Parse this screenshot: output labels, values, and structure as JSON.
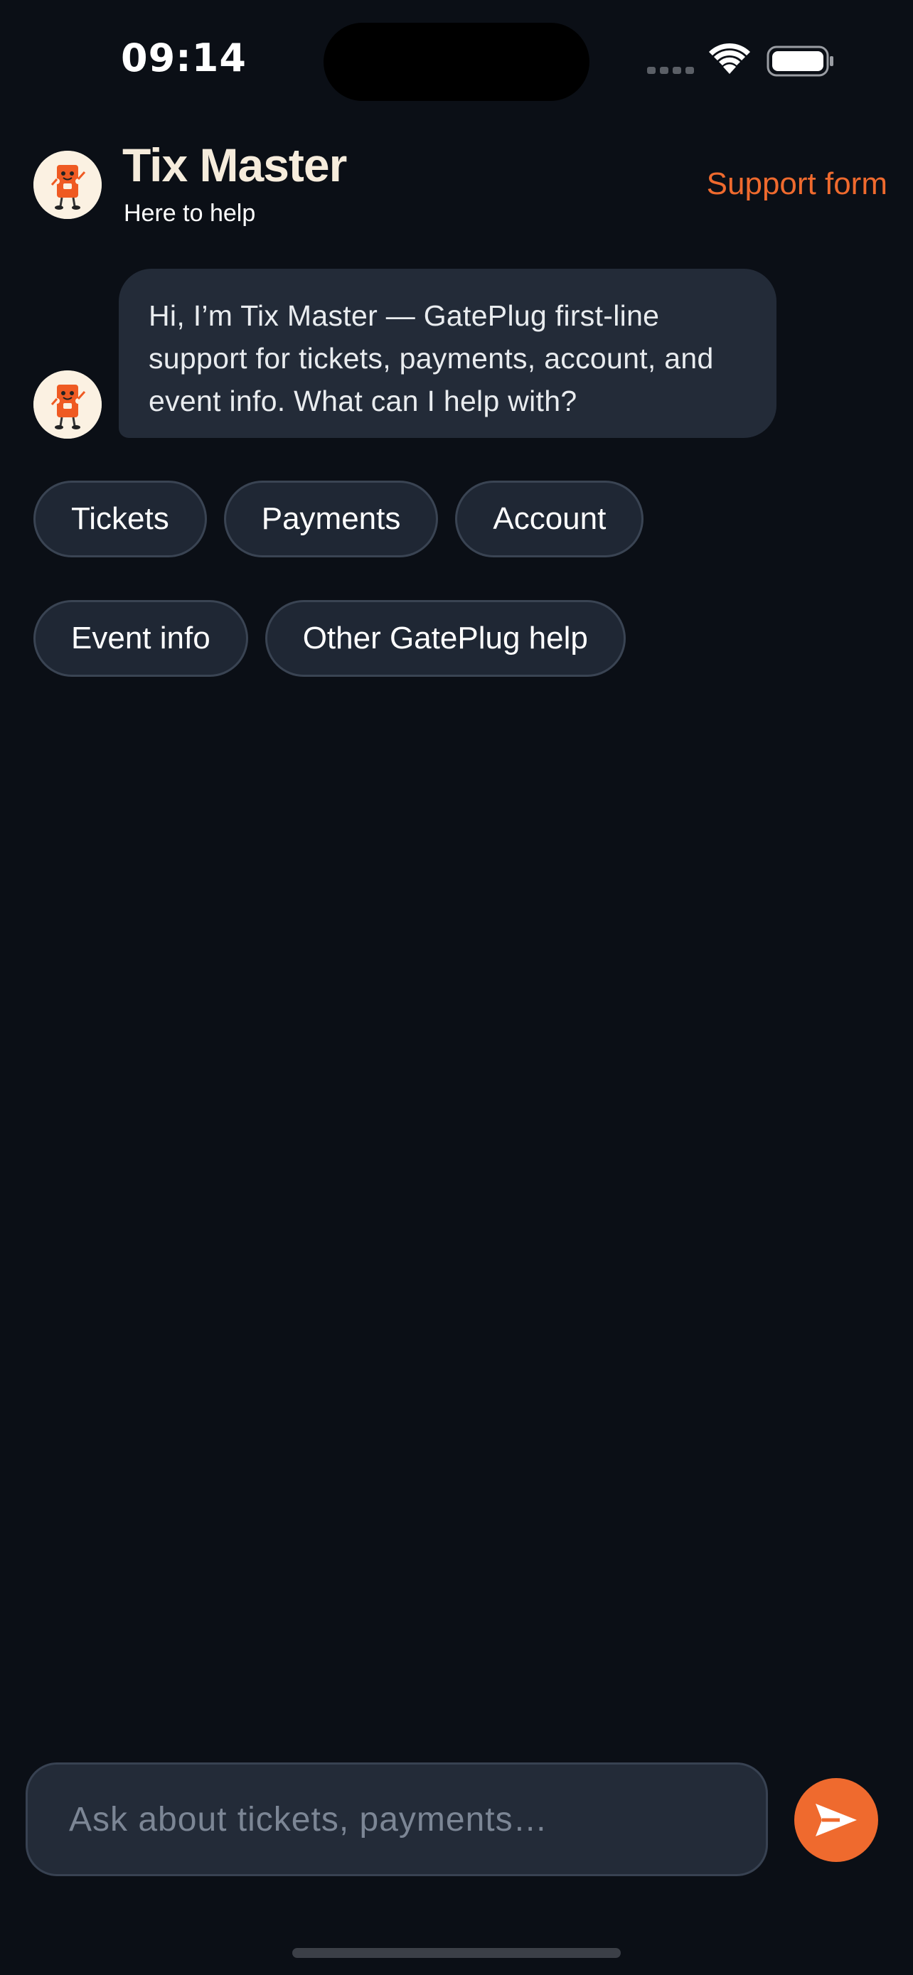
{
  "status_bar": {
    "time": "09:14"
  },
  "header": {
    "title": "Tix Master",
    "subtitle": "Here to help",
    "support_link": "Support form",
    "avatar_icon": "ticket-mascot-icon"
  },
  "messages": [
    {
      "sender": "bot",
      "text": "Hi, I’m Tix Master — GatePlug first-line support for tickets, payments, account, and event info. What can I help with?"
    }
  ],
  "quick_replies": {
    "row1": [
      "Tickets",
      "Payments",
      "Account"
    ],
    "row2": [
      "Event info",
      "Other GatePlug help"
    ]
  },
  "composer": {
    "placeholder": "Ask about tickets, payments…",
    "send_icon": "send-icon"
  },
  "colors": {
    "background": "#0b0f16",
    "accent": "#ef6a2e",
    "bubble": "#232b38",
    "title": "#f6ecdc"
  }
}
